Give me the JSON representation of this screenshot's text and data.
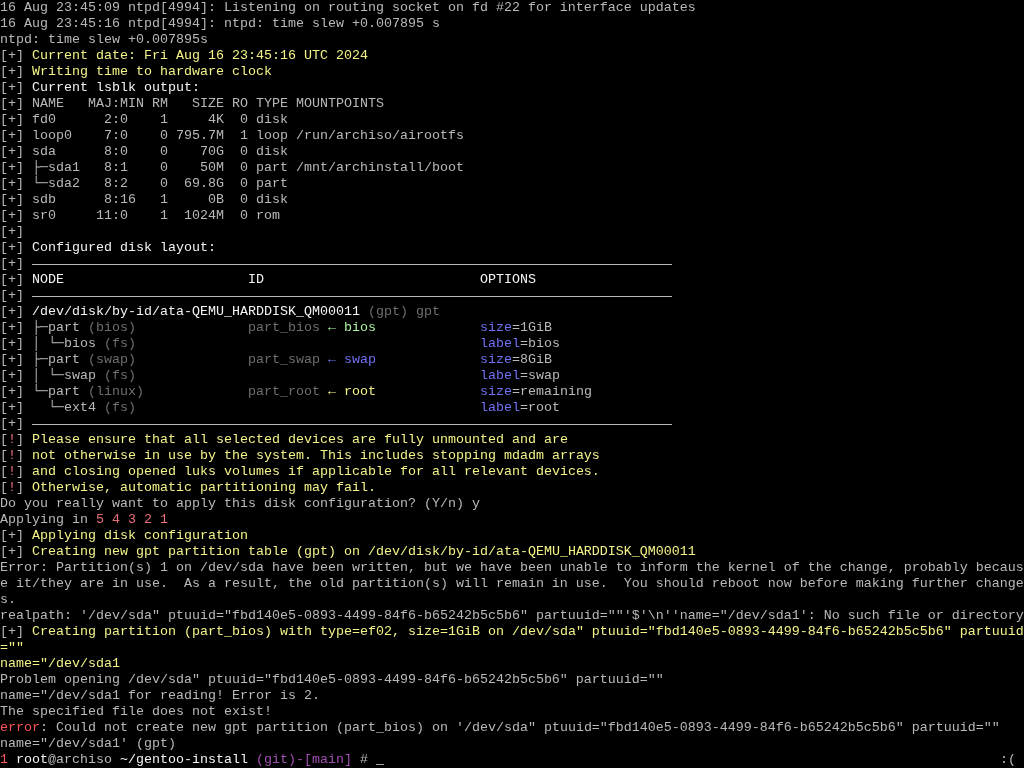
{
  "terminal": {
    "lines": [
      {
        "spans": [
          {
            "kind": "plain",
            "text": "16 Aug 23:45:09 ntpd[4994]: Listening on routing socket on fd #22 for interface updates"
          }
        ]
      },
      {
        "spans": [
          {
            "kind": "plain",
            "text": "16 Aug 23:45:16 ntpd[4994]: ntpd: time slew +0.007895 s"
          }
        ]
      },
      {
        "spans": [
          {
            "kind": "plain",
            "text": "ntpd: time slew +0.007895s"
          }
        ]
      },
      {
        "spans": [
          {
            "kind": "plain",
            "text": "[+] "
          },
          {
            "kind": "yellow",
            "text": "Current date: Fri Aug 16 23:45:16 UTC 2024"
          }
        ]
      },
      {
        "spans": [
          {
            "kind": "plain",
            "text": "[+] "
          },
          {
            "kind": "yellow",
            "text": "Writing time to hardware clock"
          }
        ]
      },
      {
        "spans": [
          {
            "kind": "plain",
            "text": "[+] "
          },
          {
            "kind": "white",
            "text": "Current lsblk output:"
          }
        ]
      },
      {
        "spans": [
          {
            "kind": "plain",
            "text": "[+] NAME   MAJ:MIN RM   SIZE RO TYPE MOUNTPOINTS"
          }
        ]
      },
      {
        "spans": [
          {
            "kind": "plain",
            "text": "[+] fd0      2:0    1     4K  0 disk"
          }
        ]
      },
      {
        "spans": [
          {
            "kind": "plain",
            "text": "[+] loop0    7:0    0 795.7M  1 loop /run/archiso/airootfs"
          }
        ]
      },
      {
        "spans": [
          {
            "kind": "plain",
            "text": "[+] sda      8:0    0    70G  0 disk"
          }
        ]
      },
      {
        "spans": [
          {
            "kind": "plain",
            "text": "[+] ├─sda1   8:1    0    50M  0 part /mnt/archinstall/boot"
          }
        ]
      },
      {
        "spans": [
          {
            "kind": "plain",
            "text": "[+] └─sda2   8:2    0  69.8G  0 part"
          }
        ]
      },
      {
        "spans": [
          {
            "kind": "plain",
            "text": "[+] sdb      8:16   1     0B  0 disk"
          }
        ]
      },
      {
        "spans": [
          {
            "kind": "plain",
            "text": "[+] sr0     11:0    1  1024M  0 rom"
          }
        ]
      },
      {
        "spans": [
          {
            "kind": "plain",
            "text": "[+]"
          }
        ]
      },
      {
        "spans": [
          {
            "kind": "plain",
            "text": "[+] "
          },
          {
            "kind": "white",
            "text": "Configured disk layout:"
          }
        ]
      },
      {
        "spans": [
          {
            "kind": "plain",
            "text": "[+] "
          },
          {
            "kind": "rule"
          }
        ]
      },
      {
        "spans": [
          {
            "kind": "plain",
            "text": "[+] "
          },
          {
            "kind": "white",
            "text": "NODE                       ID                           OPTIONS"
          }
        ]
      },
      {
        "spans": [
          {
            "kind": "plain",
            "text": "[+] "
          },
          {
            "kind": "rule"
          }
        ]
      },
      {
        "spans": [
          {
            "kind": "plain",
            "text": "[+] "
          },
          {
            "kind": "white",
            "text": "/dev/disk/by-id/ata-QEMU_HARDDISK_QM00011"
          },
          {
            "kind": "dim",
            "text": " (gpt) gpt"
          }
        ]
      },
      {
        "spans": [
          {
            "kind": "plain",
            "text": "[+] ├─part"
          },
          {
            "kind": "dim",
            "text": " (bios)              part_bios"
          },
          {
            "kind": "green",
            "text": " ← bios             "
          },
          {
            "kind": "blue",
            "text": "size"
          },
          {
            "kind": "plain",
            "text": "=1GiB"
          }
        ]
      },
      {
        "spans": [
          {
            "kind": "plain",
            "text": "[+] │ └─bios"
          },
          {
            "kind": "dim",
            "text": " (fs)                                           "
          },
          {
            "kind": "blue",
            "text": "label"
          },
          {
            "kind": "plain",
            "text": "=bios"
          }
        ]
      },
      {
        "spans": [
          {
            "kind": "plain",
            "text": "[+] ├─part"
          },
          {
            "kind": "dim",
            "text": " (swap)              part_swap"
          },
          {
            "kind": "blue",
            "text": " ← swap             size"
          },
          {
            "kind": "plain",
            "text": "=8GiB"
          }
        ]
      },
      {
        "spans": [
          {
            "kind": "plain",
            "text": "[+] │ └─swap"
          },
          {
            "kind": "dim",
            "text": " (fs)                                           "
          },
          {
            "kind": "blue",
            "text": "label"
          },
          {
            "kind": "plain",
            "text": "=swap"
          }
        ]
      },
      {
        "spans": [
          {
            "kind": "plain",
            "text": "[+] └─part"
          },
          {
            "kind": "dim",
            "text": " (linux)             part_root"
          },
          {
            "kind": "yellow",
            "text": " ← root             "
          },
          {
            "kind": "blue",
            "text": "size"
          },
          {
            "kind": "plain",
            "text": "=remaining"
          }
        ]
      },
      {
        "spans": [
          {
            "kind": "plain",
            "text": "[+]   └─ext4"
          },
          {
            "kind": "dim",
            "text": " (fs)                                           "
          },
          {
            "kind": "blue",
            "text": "label"
          },
          {
            "kind": "plain",
            "text": "=root"
          }
        ]
      },
      {
        "spans": [
          {
            "kind": "plain",
            "text": "[+] "
          },
          {
            "kind": "rule"
          }
        ]
      },
      {
        "spans": [
          {
            "kind": "plain",
            "text": "["
          },
          {
            "kind": "red",
            "text": "!"
          },
          {
            "kind": "plain",
            "text": "] "
          },
          {
            "kind": "yellow",
            "text": "Please ensure that all selected devices are fully unmounted and are"
          }
        ]
      },
      {
        "spans": [
          {
            "kind": "plain",
            "text": "["
          },
          {
            "kind": "red",
            "text": "!"
          },
          {
            "kind": "plain",
            "text": "] "
          },
          {
            "kind": "yellow",
            "text": "not otherwise in use by the system. This includes stopping mdadm arrays"
          }
        ]
      },
      {
        "spans": [
          {
            "kind": "plain",
            "text": "["
          },
          {
            "kind": "red",
            "text": "!"
          },
          {
            "kind": "plain",
            "text": "] "
          },
          {
            "kind": "yellow",
            "text": "and closing opened luks volumes if applicable for all relevant devices."
          }
        ]
      },
      {
        "spans": [
          {
            "kind": "plain",
            "text": "["
          },
          {
            "kind": "red",
            "text": "!"
          },
          {
            "kind": "plain",
            "text": "] "
          },
          {
            "kind": "yellow",
            "text": "Otherwise, automatic partitioning may fail."
          }
        ]
      },
      {
        "spans": [
          {
            "kind": "plain",
            "text": "Do you really want to apply this disk configuration? (Y/n) y"
          }
        ]
      },
      {
        "spans": [
          {
            "kind": "plain",
            "text": "Applying in "
          },
          {
            "kind": "red",
            "text": "5 4 3 2 1"
          }
        ]
      },
      {
        "spans": [
          {
            "kind": "plain",
            "text": "[+] "
          },
          {
            "kind": "yellow",
            "text": "Applying disk configuration"
          }
        ]
      },
      {
        "spans": [
          {
            "kind": "plain",
            "text": "[+] "
          },
          {
            "kind": "yellow",
            "text": "Creating new gpt partition table (gpt) on /dev/disk/by-id/ata-QEMU_HARDDISK_QM00011"
          }
        ]
      },
      {
        "spans": [
          {
            "kind": "plain",
            "text": "Error: Partition(s) 1 on /dev/sda have been written, but we have been unable to inform the kernel of the change, probably becaus"
          }
        ]
      },
      {
        "spans": [
          {
            "kind": "plain",
            "text": "e it/they are in use.  As a result, the old partition(s) will remain in use.  You should reboot now before making further change"
          }
        ]
      },
      {
        "spans": [
          {
            "kind": "plain",
            "text": "s."
          }
        ]
      },
      {
        "spans": [
          {
            "kind": "plain",
            "text": "realpath: '/dev/sda\" ptuuid=\"fbd140e5-0893-4499-84f6-b65242b5c5b6\" partuuid=\"\"'$'\\n''name=\"/dev/sda1': No such file or directory"
          }
        ]
      },
      {
        "spans": [
          {
            "kind": "plain",
            "text": "[+] "
          },
          {
            "kind": "yellow",
            "text": "Creating partition (part_bios) with type=ef02, size=1GiB on /dev/sda\" ptuuid=\"fbd140e5-0893-4499-84f6-b65242b5c5b6\" partuuid"
          }
        ]
      },
      {
        "spans": [
          {
            "kind": "yellow",
            "text": "=\"\""
          }
        ]
      },
      {
        "spans": [
          {
            "kind": "yellow",
            "text": "name=\"/dev/sda1"
          }
        ]
      },
      {
        "spans": [
          {
            "kind": "plain",
            "text": "Problem opening /dev/sda\" ptuuid=\"fbd140e5-0893-4499-84f6-b65242b5c5b6\" partuuid=\"\""
          }
        ]
      },
      {
        "spans": [
          {
            "kind": "plain",
            "text": "name=\"/dev/sda1 for reading! Error is 2."
          }
        ]
      },
      {
        "spans": [
          {
            "kind": "plain",
            "text": "The specified file does not exist!"
          }
        ]
      },
      {
        "spans": [
          {
            "kind": "error",
            "text": "error"
          },
          {
            "kind": "plain",
            "text": ": Could not create new gpt partition (part_bios) on '/dev/sda\" ptuuid=\"fbd140e5-0893-4499-84f6-b65242b5c5b6\" partuuid=\"\""
          }
        ]
      },
      {
        "spans": [
          {
            "kind": "plain",
            "text": "name=\"/dev/sda1' (gpt)"
          }
        ]
      },
      {
        "spans": [
          {
            "kind": "error",
            "text": "1"
          },
          {
            "kind": "white",
            "text": " root"
          },
          {
            "kind": "plain",
            "text": "@archiso"
          },
          {
            "kind": "white",
            "text": " ~/gentoo-install"
          },
          {
            "kind": "purple",
            "text": " (git)-[main]"
          },
          {
            "kind": "plain",
            "text": " # "
          },
          {
            "kind": "white",
            "text": "_"
          },
          {
            "kind": "status",
            "text": ":("
          }
        ]
      }
    ]
  }
}
